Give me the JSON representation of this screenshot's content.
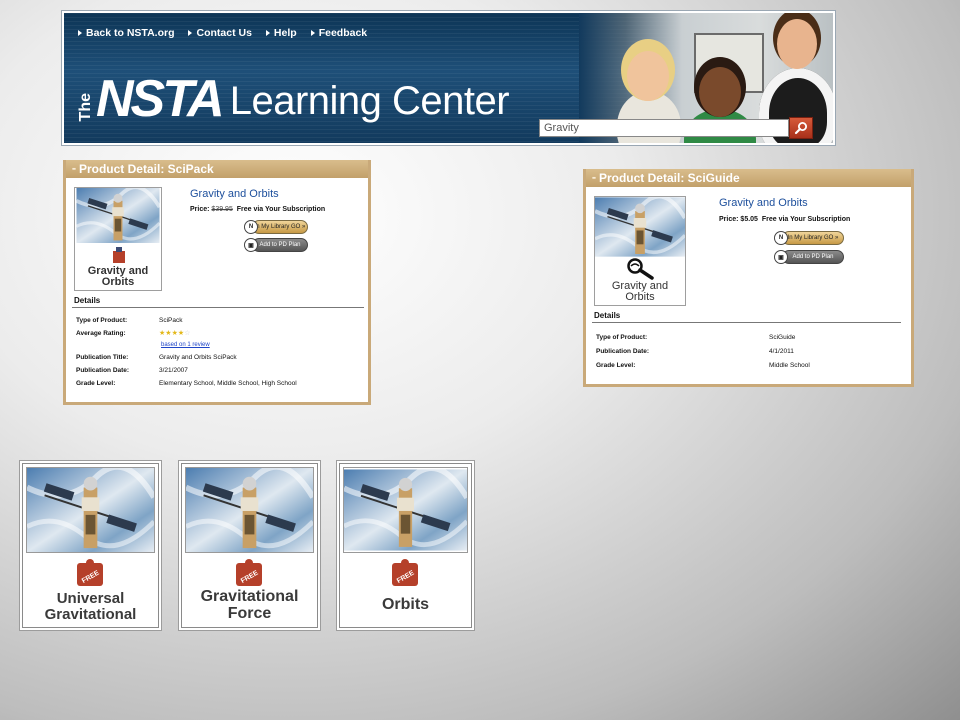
{
  "banner": {
    "nav": [
      "Back to NSTA.org",
      "Contact Us",
      "Help",
      "Feedback"
    ],
    "logo_the": "The",
    "logo_nsta": "NSTA",
    "logo_rest": "Learning Center",
    "search_value": "Gravity"
  },
  "sci_pack": {
    "header": "Product Detail: SciPack",
    "thumb_label": "Gravity and Orbits",
    "title": "Gravity and Orbits",
    "price_label": "Price:",
    "price_old": "$39.95",
    "price_note": "Free via Your Subscription",
    "btn_library": "In My Library",
    "btn_library_sub": "GO »",
    "btn_pd": "Add to PD Plan",
    "details_heading": "Details",
    "rows": [
      {
        "key": "Type of Product:",
        "value": "SciPack"
      },
      {
        "key": "Average Rating:",
        "value": ""
      },
      {
        "key": "Publication Title:",
        "value": "Gravity and Orbits SciPack"
      },
      {
        "key": "Publication Date:",
        "value": "3/21/2007"
      },
      {
        "key": "Grade Level:",
        "value": "Elementary School, Middle School, High School"
      }
    ],
    "rating": 4,
    "rating_max": 5,
    "review_link": "based on 1 review"
  },
  "sci_guide": {
    "header": "Product Detail: SciGuide",
    "thumb_label": "Gravity and Orbits",
    "title": "Gravity and Orbits",
    "price_label": "Price:",
    "price": "$5.05",
    "price_note": "Free via Your Subscription",
    "btn_library": "In My Library",
    "btn_library_sub": "GO »",
    "btn_pd": "Add to PD Plan",
    "details_heading": "Details",
    "rows": [
      {
        "key": "Type of Product:",
        "value": "SciGuide"
      },
      {
        "key": "Publication Date:",
        "value": "4/1/2011"
      },
      {
        "key": "Grade Level:",
        "value": "Middle School"
      }
    ]
  },
  "cards": [
    {
      "badge": "FREE",
      "label_1": "Universal",
      "label_2": "Gravitational"
    },
    {
      "badge": "FREE",
      "label_1": "Gravitational",
      "label_2": "Force"
    },
    {
      "badge": "FREE",
      "label_1": "Orbits",
      "label_2": ""
    }
  ],
  "colors": {
    "banner_blue": "#1e4f78",
    "panel_tan": "#c9a979",
    "title_blue": "#1d4f9c",
    "badge_red": "#b5402a"
  }
}
